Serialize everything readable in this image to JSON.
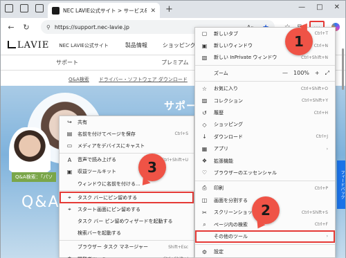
{
  "browser": {
    "tab_title": "NEC LAVIE公式サイト > サービス&サ",
    "new_tab_symbol": "+",
    "url": "https://support.nec-lavie.jp",
    "more_button_label": "…",
    "window_controls": [
      "—",
      "□",
      "✕"
    ]
  },
  "site": {
    "logo": "LAVIE",
    "site_name": "NEC LAVIE公式サイト",
    "nav": [
      "製品情報",
      "ショッピング"
    ],
    "subnav": [
      "サポート",
      "プレミアム"
    ],
    "links": [
      "Q&A検索",
      "ドライバー・ソフトウェア ダウンロード"
    ],
    "hero_title": "サポー",
    "qa_tag": "Q&A検索：「パソ",
    "qa_big": "Q&Aを",
    "feedback": "フィードバック"
  },
  "context_menu": {
    "items": [
      {
        "icon": "share-icon",
        "glyph": "↪",
        "label": "共有",
        "shortcut": ""
      },
      {
        "icon": "save-icon",
        "glyph": "▤",
        "label": "名前を付けてページを保存",
        "shortcut": "Ctrl+S"
      },
      {
        "icon": "cast-icon",
        "glyph": "▭",
        "label": "メディアをデバイスにキャスト",
        "shortcut": ""
      },
      {
        "sep": true
      },
      {
        "icon": "read-aloud-icon",
        "glyph": "A",
        "label": "音声で読み上げる",
        "shortcut": "Ctrl+Shift+U"
      },
      {
        "icon": "tools-icon",
        "glyph": "▣",
        "label": "収益ツールキット",
        "shortcut": ""
      },
      {
        "icon": "",
        "glyph": "",
        "label": "ウィンドウに名前を付ける...",
        "shortcut": ""
      },
      {
        "sep": true
      },
      {
        "icon": "pin-icon",
        "glyph": "⌖",
        "label": "タスク バーにピン留めする",
        "shortcut": "",
        "highlight": true
      },
      {
        "icon": "pin-start-icon",
        "glyph": "⌖",
        "label": "スタート画面にピン留めする",
        "shortcut": ""
      },
      {
        "icon": "",
        "glyph": "",
        "label": "タスク バー ピン留めウィザードを起動する",
        "shortcut": ""
      },
      {
        "icon": "",
        "glyph": "",
        "label": "検索バーを起動する",
        "shortcut": ""
      },
      {
        "sep": true
      },
      {
        "icon": "",
        "glyph": "",
        "label": "ブラウザー タスク マネージャー",
        "shortcut": "Shift+Esc"
      },
      {
        "icon": "devtools-icon",
        "glyph": "⚙",
        "label": "開発者ツール",
        "shortcut": "Ctrl+Shift+I"
      }
    ]
  },
  "edge_menu": {
    "zoom_label": "ズーム",
    "zoom_value": "100%",
    "items": [
      {
        "icon": "new-tab-icon",
        "glyph": "▢",
        "label": "新しいタブ",
        "shortcut": "Ctrl+T"
      },
      {
        "icon": "new-window-icon",
        "glyph": "▣",
        "label": "新しいウィンドウ",
        "shortcut": "Ctrl+N"
      },
      {
        "icon": "inprivate-icon",
        "glyph": "▧",
        "label": "新しい InPrivate ウィンドウ",
        "shortcut": "Ctrl+Shift+N"
      },
      {
        "sep": true
      },
      {
        "zoom": true
      },
      {
        "sep": true
      },
      {
        "icon": "favorites-icon",
        "glyph": "☆",
        "label": "お気に入り",
        "shortcut": "Ctrl+Shift+O"
      },
      {
        "icon": "collections-icon",
        "glyph": "▨",
        "label": "コレクション",
        "shortcut": "Ctrl+Shift+Y"
      },
      {
        "icon": "history-icon",
        "glyph": "↺",
        "label": "履歴",
        "shortcut": "Ctrl+H"
      },
      {
        "icon": "shopping-icon",
        "glyph": "◇",
        "label": "ショッピング",
        "shortcut": ""
      },
      {
        "icon": "download-icon",
        "glyph": "↓",
        "label": "ダウンロード",
        "shortcut": "Ctrl+J"
      },
      {
        "icon": "apps-icon",
        "glyph": "▦",
        "label": "アプリ",
        "shortcut": "›"
      },
      {
        "icon": "extensions-icon",
        "glyph": "❖",
        "label": "拡張機能",
        "shortcut": ""
      },
      {
        "icon": "essentials-icon",
        "glyph": "♡",
        "label": "ブラウザーのエッセンシャル",
        "shortcut": ""
      },
      {
        "sep": true
      },
      {
        "icon": "print-icon",
        "glyph": "⎙",
        "label": "印刷",
        "shortcut": "Ctrl+P"
      },
      {
        "icon": "split-screen-icon",
        "glyph": "◫",
        "label": "画面を分割する",
        "shortcut": ""
      },
      {
        "icon": "screenshot-icon",
        "glyph": "✂",
        "label": "スクリーンショット",
        "shortcut": "Ctrl+Shift+S"
      },
      {
        "icon": "find-icon",
        "glyph": "⌕",
        "label": "ページ内の検索",
        "shortcut": "Ctrl+F"
      },
      {
        "icon": "",
        "glyph": "",
        "label": "その他のツール",
        "shortcut": "›",
        "highlight": true
      },
      {
        "sep": true
      },
      {
        "icon": "settings-icon",
        "glyph": "⚙",
        "label": "設定",
        "shortcut": ""
      }
    ]
  },
  "badges": [
    "1",
    "2",
    "3"
  ],
  "colors": {
    "accent_red": "#e53935",
    "badge": "#ef5346",
    "edge_blue": "#1a56db"
  }
}
